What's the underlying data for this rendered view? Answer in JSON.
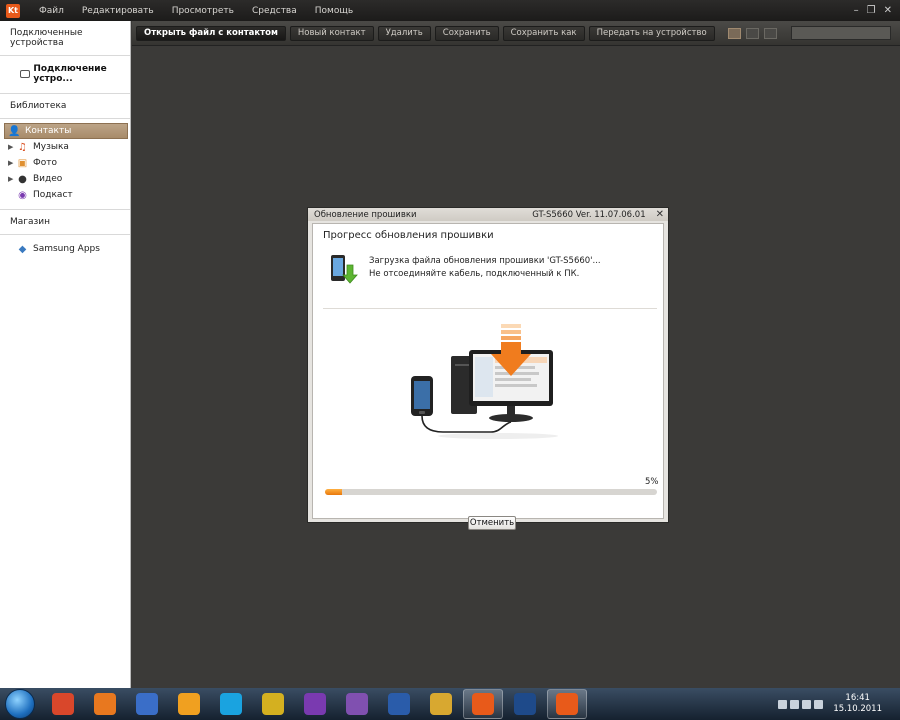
{
  "app": {
    "logo": "Kt"
  },
  "menu": [
    "Файл",
    "Редактировать",
    "Просмотреть",
    "Средства",
    "Помощь"
  ],
  "window_controls": [
    "–",
    "❐",
    "✕"
  ],
  "sidebar": {
    "connected_heading": "Подключенные устройства",
    "device_label": "Подключение устро...",
    "library_heading": "Библиотека",
    "library_items": [
      {
        "label": "Контакты",
        "icon": "contacts-icon",
        "selected": true,
        "expandable": false
      },
      {
        "label": "Музыка",
        "icon": "music-icon",
        "selected": false,
        "expandable": true
      },
      {
        "label": "Фото",
        "icon": "photo-icon",
        "selected": false,
        "expandable": true
      },
      {
        "label": "Видео",
        "icon": "video-icon",
        "selected": false,
        "expandable": true
      },
      {
        "label": "Подкаст",
        "icon": "podcast-icon",
        "selected": false,
        "expandable": false
      }
    ],
    "store_heading": "Магазин",
    "store_items": [
      {
        "label": "Samsung Apps",
        "icon": "samsung-apps-icon"
      }
    ]
  },
  "toolbar": {
    "buttons": [
      "Открыть файл с контактом",
      "Новый контакт",
      "Удалить",
      "Сохранить",
      "Сохранить как",
      "Передать на устройство"
    ],
    "search_placeholder": ""
  },
  "dialog": {
    "title": "Обновление прошивки",
    "version": "GT-S5660 Ver. 11.07.06.01",
    "heading": "Прогресс обновления прошивки",
    "message_line1": "Загрузка файла обновления прошивки 'GT-S5660'...",
    "message_line2": "Не отсоединяйте кабель, подключенный к ПК.",
    "progress_percent": 5,
    "progress_label": "5%",
    "cancel_label": "Отменить"
  },
  "taskbar": {
    "apps": [
      {
        "name": "chrome-icon",
        "color": "#d9472b"
      },
      {
        "name": "firefox-icon",
        "color": "#e8781f"
      },
      {
        "name": "save-disk-icon",
        "color": "#3a6ec8"
      },
      {
        "name": "aimp-icon",
        "color": "#f0a020"
      },
      {
        "name": "skype-icon",
        "color": "#1aa3e0"
      },
      {
        "name": "winamp-icon",
        "color": "#d4b020"
      },
      {
        "name": "picasa-icon",
        "color": "#7a3ab0"
      },
      {
        "name": "pidgin-icon",
        "color": "#8050b0"
      },
      {
        "name": "word-icon",
        "color": "#2a5caa"
      },
      {
        "name": "explorer-folder-icon",
        "color": "#d8a830"
      },
      {
        "name": "kies-icon",
        "color": "#e85a1a",
        "active": true
      },
      {
        "name": "photoshop-icon",
        "color": "#1e4a8a"
      },
      {
        "name": "kies-2-icon",
        "color": "#e85a1a",
        "active": true
      }
    ],
    "time": "16:41",
    "date": "15.10.2011"
  }
}
